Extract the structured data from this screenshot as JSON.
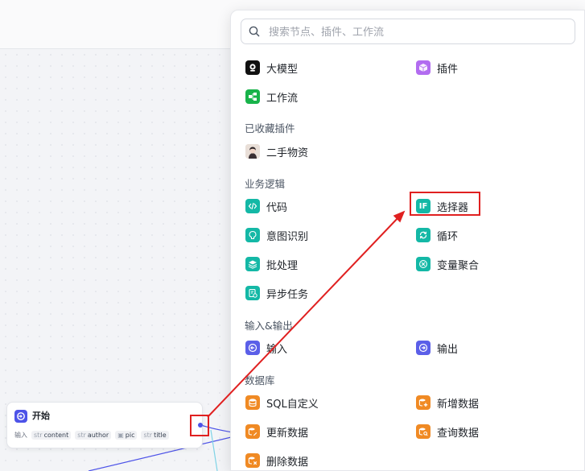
{
  "search": {
    "placeholder": "搜索节点、插件、工作流"
  },
  "top_items": [
    {
      "label": "大模型",
      "icon": "llm-icon",
      "color": "#111111"
    },
    {
      "label": "插件",
      "icon": "plugin-icon",
      "color": "#b26cf0"
    },
    {
      "label": "工作流",
      "icon": "workflow-icon",
      "color": "#18b34a"
    }
  ],
  "sections": {
    "favorites": {
      "title": "已收藏插件",
      "items": [
        {
          "label": "二手物资",
          "icon": "avatar-icon"
        }
      ]
    },
    "logic": {
      "title": "业务逻辑",
      "items": [
        {
          "label": "代码",
          "icon": "code-icon",
          "color": "#14b8a6"
        },
        {
          "label": "选择器",
          "icon": "if-icon",
          "color": "#14b8a6",
          "icon_text": "IF"
        },
        {
          "label": "意图识别",
          "icon": "intent-icon",
          "color": "#14b8a6"
        },
        {
          "label": "循环",
          "icon": "loop-icon",
          "color": "#14b8a6"
        },
        {
          "label": "批处理",
          "icon": "batch-icon",
          "color": "#14b8a6"
        },
        {
          "label": "变量聚合",
          "icon": "aggregate-icon",
          "color": "#14b8a6"
        },
        {
          "label": "异步任务",
          "icon": "async-task-icon",
          "color": "#14b8a6"
        }
      ]
    },
    "io": {
      "title": "输入&输出",
      "items": [
        {
          "label": "输入",
          "icon": "input-icon",
          "color": "#5b5fe8"
        },
        {
          "label": "输出",
          "icon": "output-icon",
          "color": "#5b5fe8"
        }
      ]
    },
    "database": {
      "title": "数据库",
      "items": [
        {
          "label": "SQL自定义",
          "icon": "sql-icon",
          "color": "#f08a24"
        },
        {
          "label": "新增数据",
          "icon": "add-data-icon",
          "color": "#f08a24"
        },
        {
          "label": "更新数据",
          "icon": "update-data-icon",
          "color": "#f08a24"
        },
        {
          "label": "查询数据",
          "icon": "query-data-icon",
          "color": "#f08a24"
        },
        {
          "label": "删除数据",
          "icon": "delete-data-icon",
          "color": "#f08a24"
        }
      ]
    }
  },
  "start_node": {
    "title": "开始",
    "input_label": "输入",
    "params": [
      {
        "type": "str",
        "name": "content"
      },
      {
        "type": "str",
        "name": "author"
      },
      {
        "type": "img",
        "name": "pic"
      },
      {
        "type": "str",
        "name": "title"
      }
    ]
  },
  "colors": {
    "annotation": "#e02020",
    "connection": "#4d53e8"
  }
}
